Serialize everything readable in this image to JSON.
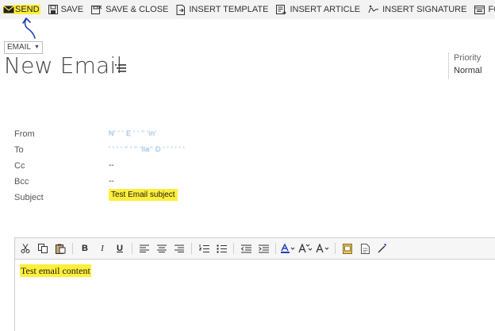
{
  "toolbar": {
    "send": "SEND",
    "save": "SAVE",
    "save_close": "SAVE & CLOSE",
    "insert_template": "INSERT TEMPLATE",
    "insert_article": "INSERT ARTICLE",
    "insert_signature": "INSERT SIGNATURE",
    "form": "FORM"
  },
  "header": {
    "entity": "EMAIL",
    "title": "New Email",
    "priority_label": "Priority",
    "priority_value": "Normal"
  },
  "fields": {
    "from_label": "From",
    "from_value": "N' ' ' E ' ' '' 'in'",
    "to_label": "To",
    "to_value": "' ' ' ' '' ' '' 'lla'' D ' ' ' ' ' '",
    "cc_label": "Cc",
    "cc_value": "--",
    "bcc_label": "Bcc",
    "bcc_value": "--",
    "subject_label": "Subject",
    "subject_value": "Test Email subject"
  },
  "editor": {
    "bold": "B",
    "italic": "I",
    "underline": "U",
    "body": "Test email content"
  },
  "colors": {
    "highlight": "#ffef3a",
    "arrow": "#1f3fbf",
    "toolbar_bg": "#f3f3f3"
  }
}
